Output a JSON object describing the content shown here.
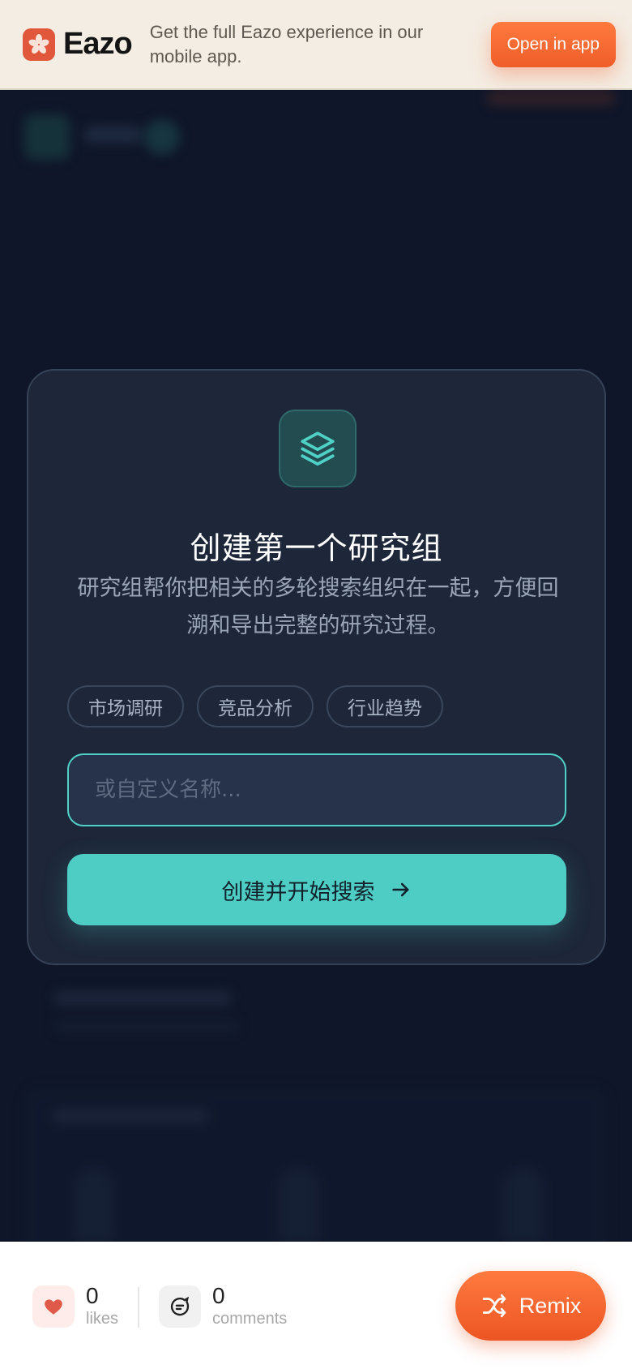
{
  "banner": {
    "brand": "Eazo",
    "message": "Get the full Eazo experience in our mobile app.",
    "open_app_label": "Open in app"
  },
  "modal": {
    "icon": "layers-icon",
    "title": "创建第一个研究组",
    "description": "研究组帮你把相关的多轮搜索组织在一起，方便回溯和导出完整的研究过程。",
    "chips": [
      "市场调研",
      "竞品分析",
      "行业趋势"
    ],
    "input": {
      "value": "",
      "placeholder": "或自定义名称..."
    },
    "create_button_label": "创建并开始搜索"
  },
  "footer": {
    "likes": {
      "count": "0",
      "label": "likes"
    },
    "comments": {
      "count": "0",
      "label": "comments"
    },
    "remix_label": "Remix"
  },
  "colors": {
    "accent_teal": "#4ecdc4",
    "accent_orange": "#ef5d28",
    "background": "#0f1629",
    "card": "#1d2739"
  }
}
